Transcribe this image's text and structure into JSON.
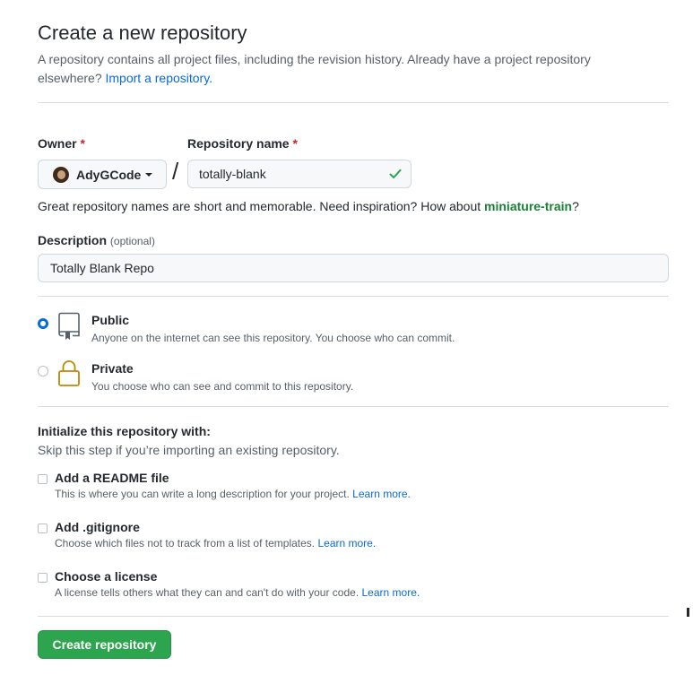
{
  "header": {
    "title": "Create a new repository",
    "intro": "A repository contains all project files, including the revision history. Already have a project repository elsewhere?",
    "import_link": "Import a repository."
  },
  "owner": {
    "label": "Owner",
    "required_mark": "*",
    "value": "AdyGCode"
  },
  "repo_name": {
    "label": "Repository name",
    "required_mark": "*",
    "value": "totally-blank",
    "separator": "/",
    "valid": true
  },
  "name_hint": {
    "text": "Great repository names are short and memorable. Need inspiration? How about",
    "suggestion": "miniature-train",
    "suffix": "?"
  },
  "description": {
    "label": "Description",
    "optional": "(optional)",
    "value": "Totally Blank Repo"
  },
  "visibility": {
    "selected": "public",
    "options": [
      {
        "title": "Public",
        "desc": "Anyone on the internet can see this repository. You choose who can commit.",
        "icon": "repo-icon"
      },
      {
        "title": "Private",
        "desc": "You choose who can see and commit to this repository.",
        "icon": "lock-icon"
      }
    ]
  },
  "init": {
    "title": "Initialize this repository with:",
    "subtitle": "Skip this step if you’re importing an existing repository.",
    "options": [
      {
        "title": "Add a README file",
        "desc": "This is where you can write a long description for your project.",
        "learn": "Learn more.",
        "checked": false
      },
      {
        "title": "Add .gitignore",
        "desc": "Choose which files not to track from a list of templates.",
        "learn": "Learn more.",
        "checked": false
      },
      {
        "title": "Choose a license",
        "desc": "A license tells others what they can and can't do with your code.",
        "learn": "Learn more.",
        "checked": false
      }
    ]
  },
  "submit": {
    "label": "Create repository"
  },
  "colors": {
    "primary_button": "#2da44e",
    "link": "#0969da",
    "success": "#1a7f37",
    "required": "#cf222e",
    "lock_icon": "#bf8700"
  }
}
